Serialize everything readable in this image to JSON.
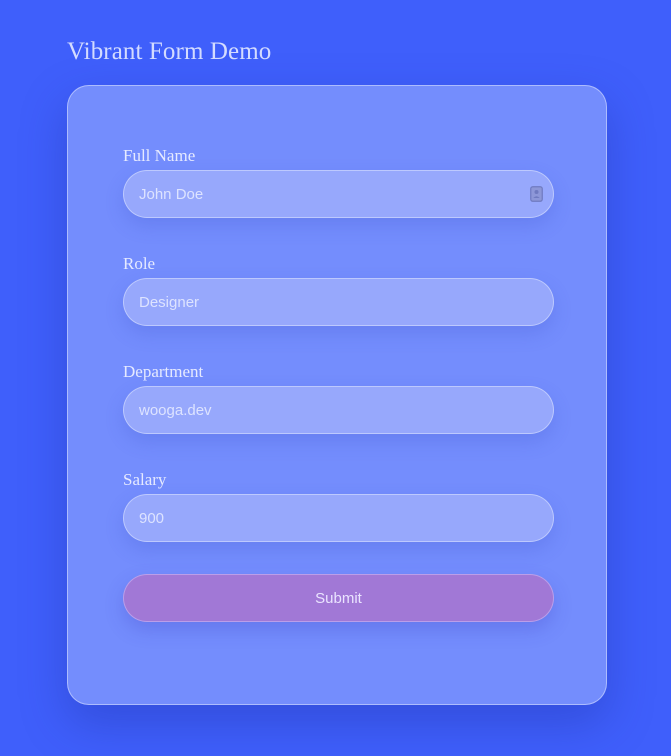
{
  "page": {
    "title": "Vibrant Form Demo"
  },
  "form": {
    "fields": [
      {
        "label": "Full Name",
        "value": "John Doe"
      },
      {
        "label": "Role",
        "value": "Designer"
      },
      {
        "label": "Department",
        "value": "wooga.dev"
      },
      {
        "label": "Salary",
        "value": "900"
      }
    ],
    "submit_label": "Submit",
    "name_field_icon": "contact-card-icon"
  },
  "colors": {
    "background": "#3f5ffb",
    "card": "#8a9cfd",
    "input": "#97a8fc",
    "submit": "#a178d6"
  }
}
